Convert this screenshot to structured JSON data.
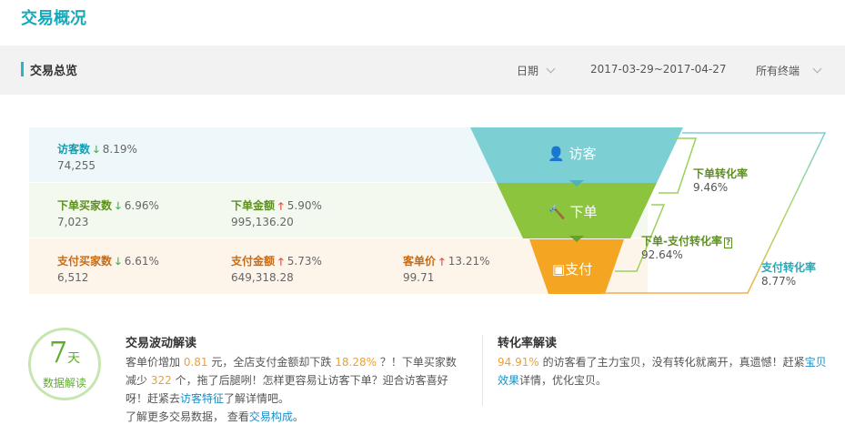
{
  "page": {
    "title": "交易概况"
  },
  "toolbar": {
    "section_title": "交易总览",
    "date_label": "日期",
    "date_range": "2017-03-29~2017-04-27",
    "terminal_label": "所有终端"
  },
  "metrics": {
    "visitors": {
      "label": "访客数",
      "pct": "8.19%",
      "value": "74,255",
      "trend": "down"
    },
    "order_buyers": {
      "label": "下单买家数",
      "pct": "6.96%",
      "value": "7,023",
      "trend": "down"
    },
    "order_amount": {
      "label": "下单金额",
      "pct": "5.90%",
      "value": "995,136.20",
      "trend": "up"
    },
    "pay_buyers": {
      "label": "支付买家数",
      "pct": "6.61%",
      "value": "6,512",
      "trend": "down"
    },
    "pay_amount": {
      "label": "支付金额",
      "pct": "5.73%",
      "value": "649,318.28",
      "trend": "up"
    },
    "unit_price": {
      "label": "客单价",
      "pct": "13.21%",
      "value": "99.71",
      "trend": "up"
    }
  },
  "funnel": {
    "visit_label": "访客",
    "order_label": "下单",
    "pay_label": "支付",
    "colors": {
      "visit": "#7ccfd3",
      "order": "#8cc43d",
      "pay": "#f4a623"
    }
  },
  "conversion": {
    "order_rate": {
      "label": "下单转化率",
      "value": "9.46%"
    },
    "order_pay_rate": {
      "label": "下单-支付转化率",
      "help": "?",
      "value": "92.64%"
    },
    "pay_rate": {
      "label": "支付转化率",
      "value": "8.77%"
    }
  },
  "badge": {
    "number": "7",
    "unit": "天",
    "caption": "数据解读"
  },
  "trade_interp": {
    "title": "交易波动解读",
    "t1": "客单价增加",
    "v1": "0.81",
    "t2": "元，全店支付金额却下跌",
    "v2": "18.28%",
    "t3": "？！下单买家数减少",
    "v3": "322",
    "t4": "个，拖了后腿咧！怎样更容易让访客下单？迎合访客喜好呀！赶紧去",
    "link1": "访客特征",
    "t5": "了解详情吧。",
    "t6": "了解更多交易数据，  查看",
    "link2": "交易构成",
    "t7": "。"
  },
  "conv_interp": {
    "title": "转化率解读",
    "v1": "94.91%",
    "t1": "的访客看了主力宝贝，没有转化就离开，真遗憾！赶紧",
    "link1": "宝贝效果",
    "t2": "详情，优化宝贝。"
  }
}
